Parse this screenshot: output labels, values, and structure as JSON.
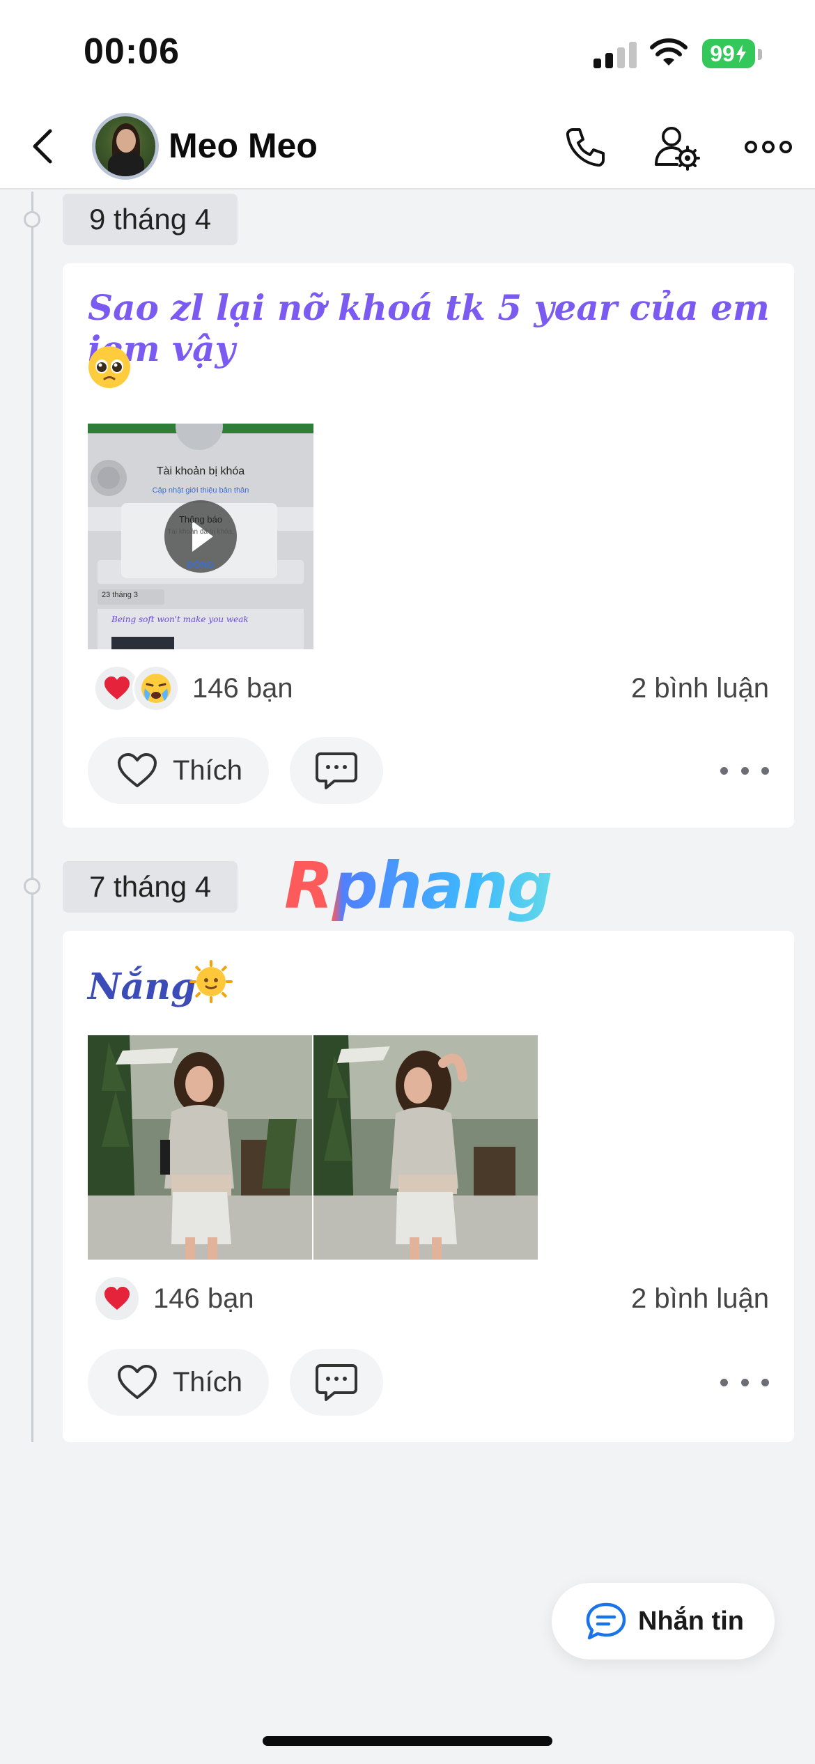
{
  "status_bar": {
    "time": "00:06",
    "battery": "99"
  },
  "header": {
    "contact_name": "Meo Meo"
  },
  "posts": [
    {
      "date": "9 tháng 4",
      "text": "Sao zl lại nỡ khoá tk 5 year của em iem vậy",
      "video_preview": {
        "title": "Tài khoản bị khóa",
        "subtitle": "Cập nhật giới thiệu bản thân",
        "dialog_title": "Thông báo",
        "dialog_body": "Tài khoản đã bị khóa.",
        "dialog_button": "ĐÓNG",
        "inner_date": "23 tháng 3",
        "inner_text": "Being soft won't make you weak"
      },
      "reaction_count": "146 bạn",
      "comment_count": "2 bình luận",
      "like_label": "Thích"
    },
    {
      "date": "7 tháng 4",
      "text": "Nắng",
      "reaction_count": "146 bạn",
      "comment_count": "2 bình luận",
      "like_label": "Thích"
    }
  ],
  "watermark": "Rphang",
  "fab": {
    "label": "Nhắn tin"
  },
  "colors": {
    "accent_purple": "#7a5af0",
    "accent_blue": "#3b4bb8",
    "battery_green": "#34c759",
    "heart_red": "#e5233b"
  }
}
